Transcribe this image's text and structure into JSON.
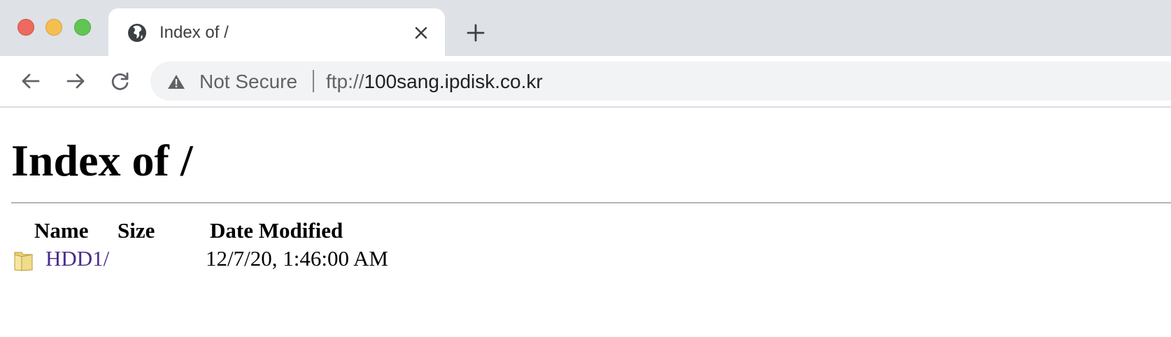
{
  "browser": {
    "tab": {
      "title": "Index of /"
    },
    "toolbar": {
      "security_label": "Not Secure",
      "url_scheme": "ftp://",
      "url_host": "100sang.ipdisk.co.kr"
    },
    "icons": {
      "tab_favicon": "globe-icon",
      "tab_close": "close-icon",
      "new_tab": "plus-icon",
      "back": "arrow-left-icon",
      "forward": "arrow-right-icon",
      "reload": "reload-icon",
      "security": "warning-triangle-icon"
    },
    "colors": {
      "tabstrip_bg": "#dee1e6",
      "omnibox_bg": "#f1f3f4",
      "traffic_close": "#ed6a5e",
      "traffic_minimize": "#f5bf4f",
      "traffic_maximize": "#61c554"
    }
  },
  "page": {
    "heading": "Index of /",
    "columns": {
      "name": "Name",
      "size": "Size",
      "date_modified": "Date Modified"
    },
    "entries": [
      {
        "icon": "folder-icon",
        "name": "HDD1/",
        "size": "",
        "date_modified": "12/7/20, 1:46:00 AM"
      }
    ],
    "colors": {
      "visited_link": "#4a2c8e"
    }
  }
}
